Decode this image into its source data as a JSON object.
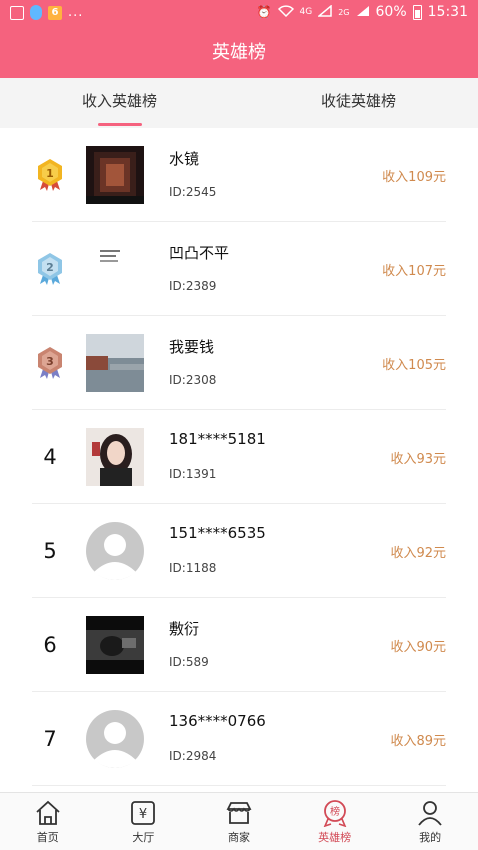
{
  "status_bar": {
    "network": "4G",
    "network2": "2G",
    "battery": "60%",
    "time": "15:31",
    "dots": "..."
  },
  "header": {
    "title": "英雄榜"
  },
  "tabs": [
    {
      "label": "收入英雄榜",
      "active": true
    },
    {
      "label": "收徒英雄榜",
      "active": false
    }
  ],
  "leaderboard": [
    {
      "rank": "1",
      "name": "水镜",
      "id": "ID:2545",
      "income": "收入109元"
    },
    {
      "rank": "2",
      "name": "凹凸不平",
      "id": "ID:2389",
      "income": "收入107元"
    },
    {
      "rank": "3",
      "name": "我要钱",
      "id": "ID:2308",
      "income": "收入105元"
    },
    {
      "rank": "4",
      "name": "181****5181",
      "id": "ID:1391",
      "income": "收入93元"
    },
    {
      "rank": "5",
      "name": "151****6535",
      "id": "ID:1188",
      "income": "收入92元"
    },
    {
      "rank": "6",
      "name": "敷衍",
      "id": "ID:589",
      "income": "收入90元"
    },
    {
      "rank": "7",
      "name": "136****0766",
      "id": "ID:2984",
      "income": "收入89元"
    }
  ],
  "bottom_nav": [
    {
      "label": "首页",
      "icon": "home-icon"
    },
    {
      "label": "大厅",
      "icon": "yuan-icon"
    },
    {
      "label": "商家",
      "icon": "shop-icon"
    },
    {
      "label": "英雄榜",
      "icon": "hero-badge-icon",
      "active": true
    },
    {
      "label": "我的",
      "icon": "user-icon"
    }
  ],
  "colors": {
    "brand": "#f5627e",
    "income": "#d08a4e",
    "gold": "#f2b521",
    "silver": "#8fc6e6",
    "bronze": "#c98470",
    "nav_active": "#d24a56"
  }
}
